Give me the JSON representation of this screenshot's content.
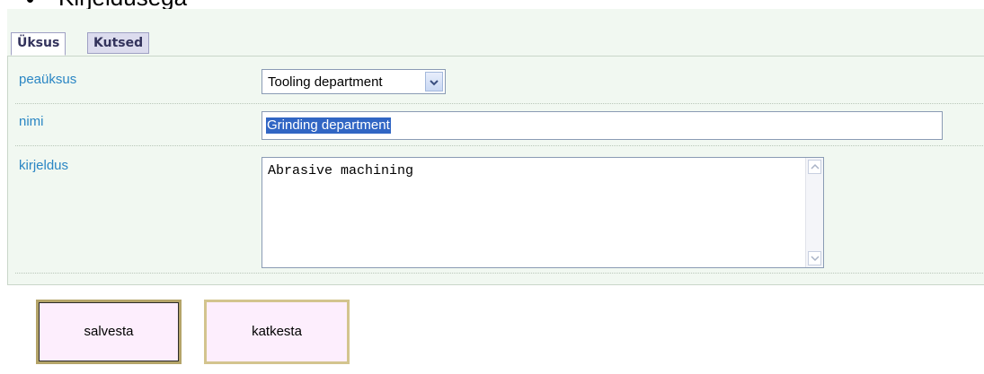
{
  "header": {
    "bullet_text": "Kirjeldusega"
  },
  "tabs": [
    {
      "label": "Üksus",
      "active": true
    },
    {
      "label": "Kutsed",
      "active": false
    }
  ],
  "form": {
    "parent": {
      "label": "peaüksus",
      "value": "Tooling department",
      "dropdown_icon": "chevron-down-icon"
    },
    "name": {
      "label": "nimi",
      "value": "Grinding department",
      "selected": true
    },
    "description": {
      "label": "kirjeldus",
      "value": "Abrasive machining"
    }
  },
  "actions": {
    "save_label": "salvesta",
    "cancel_label": "katkesta"
  },
  "colors": {
    "panel_bg": "#f1f8f1",
    "label": "#2a86c4",
    "tab_text": "#33335c",
    "button_bg": "#fdeefd",
    "button_border": "#d3c48e",
    "selection": "#3166c4"
  }
}
